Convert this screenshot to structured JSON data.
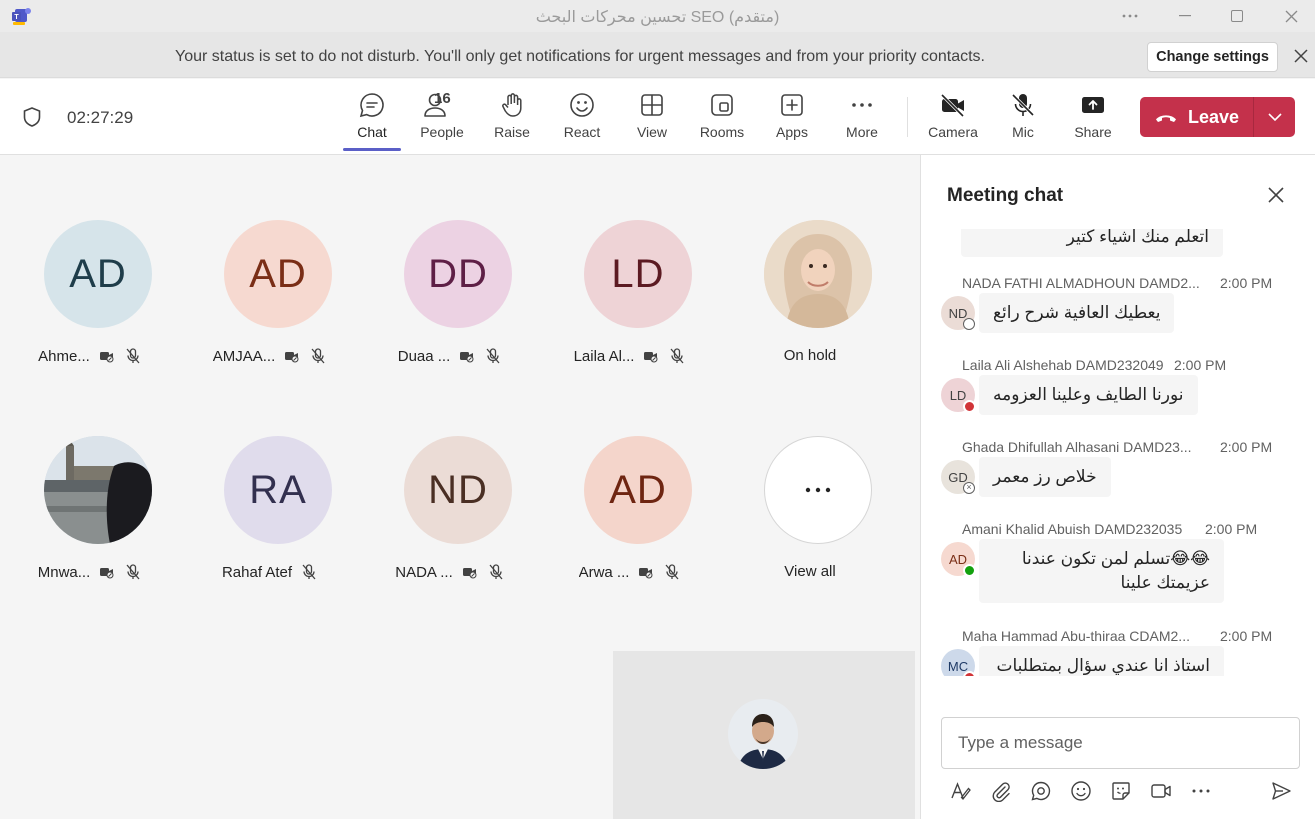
{
  "window": {
    "title": "تحسين محركات البحث SEO (متقدم)"
  },
  "notification": {
    "text": "Your status is set to do not disturb. You'll only get notifications for urgent messages and from your priority contacts.",
    "button": "Change settings"
  },
  "toolbar": {
    "timer": "02:27:29",
    "chat": "Chat",
    "people": "People",
    "people_count": "16",
    "raise": "Raise",
    "react": "React",
    "view": "View",
    "rooms": "Rooms",
    "apps": "Apps",
    "more": "More",
    "camera": "Camera",
    "mic": "Mic",
    "share": "Share",
    "leave": "Leave"
  },
  "participants": [
    {
      "initials": "AD",
      "name": "Ahme...",
      "bg": "#d6e4ea",
      "fg": "#1f3d4a"
    },
    {
      "initials": "AD",
      "name": "AMJAA...",
      "bg": "#f6d9d0",
      "fg": "#7a2e16"
    },
    {
      "initials": "DD",
      "name": "Duaa ...",
      "bg": "#ecd2e3",
      "fg": "#5e1f46"
    },
    {
      "initials": "LD",
      "name": "Laila Al...",
      "bg": "#eed3d6",
      "fg": "#5c1a22"
    },
    {
      "initials": "",
      "name": "On hold",
      "bg": "#e8d5c2",
      "fg": "#000000"
    },
    {
      "initials": "",
      "name": "Mnwa...",
      "bg": "#8a8f93",
      "fg": "#000000"
    },
    {
      "initials": "RA",
      "name": "Rahaf Atef",
      "bg": "#e0dcec",
      "fg": "#33304f"
    },
    {
      "initials": "ND",
      "name": "NADA ...",
      "bg": "#ebdcd6",
      "fg": "#4a2f24"
    },
    {
      "initials": "AD",
      "name": "Arwa ...",
      "bg": "#f4d5cb",
      "fg": "#6e2511"
    },
    {
      "initials": "",
      "name": "View all",
      "bg": "#ffffff",
      "fg": "#242424"
    }
  ],
  "chat": {
    "title": "Meeting chat",
    "messages": [
      {
        "sender": "",
        "time": "",
        "initials": "",
        "text": "اتعلم منك اشياء كتير"
      },
      {
        "sender": "NADA FATHI ALMADHOUN DAMD2...",
        "time": "2:00 PM",
        "initials": "ND",
        "text": "يعطيك العافية شرح رائع"
      },
      {
        "sender": "Laila Ali Alshehab DAMD232049",
        "time": "2:00 PM",
        "initials": "LD",
        "text": "نورنا الطايف وعلينا العزومه"
      },
      {
        "sender": "Ghada Dhifullah Alhasani DAMD23...",
        "time": "2:00 PM",
        "initials": "GD",
        "text": "خلاص رز معمر"
      },
      {
        "sender": "Amani Khalid Abuish DAMD232035",
        "time": "2:00 PM",
        "initials": "AD",
        "text": "😂😂تسلم لمن تكون عندنا عزيمتك علينا"
      },
      {
        "sender": "Maha Hammad Abu-thiraa CDAM2...",
        "time": "2:00 PM",
        "initials": "MC",
        "text": "استاذ انا عندي سؤال بمتطلبات"
      }
    ],
    "compose_placeholder": "Type a message"
  },
  "colors": {
    "accent": "#5b5fc7",
    "leave": "#c4314b",
    "dnd": "#d13438",
    "available": "#13a10e"
  }
}
